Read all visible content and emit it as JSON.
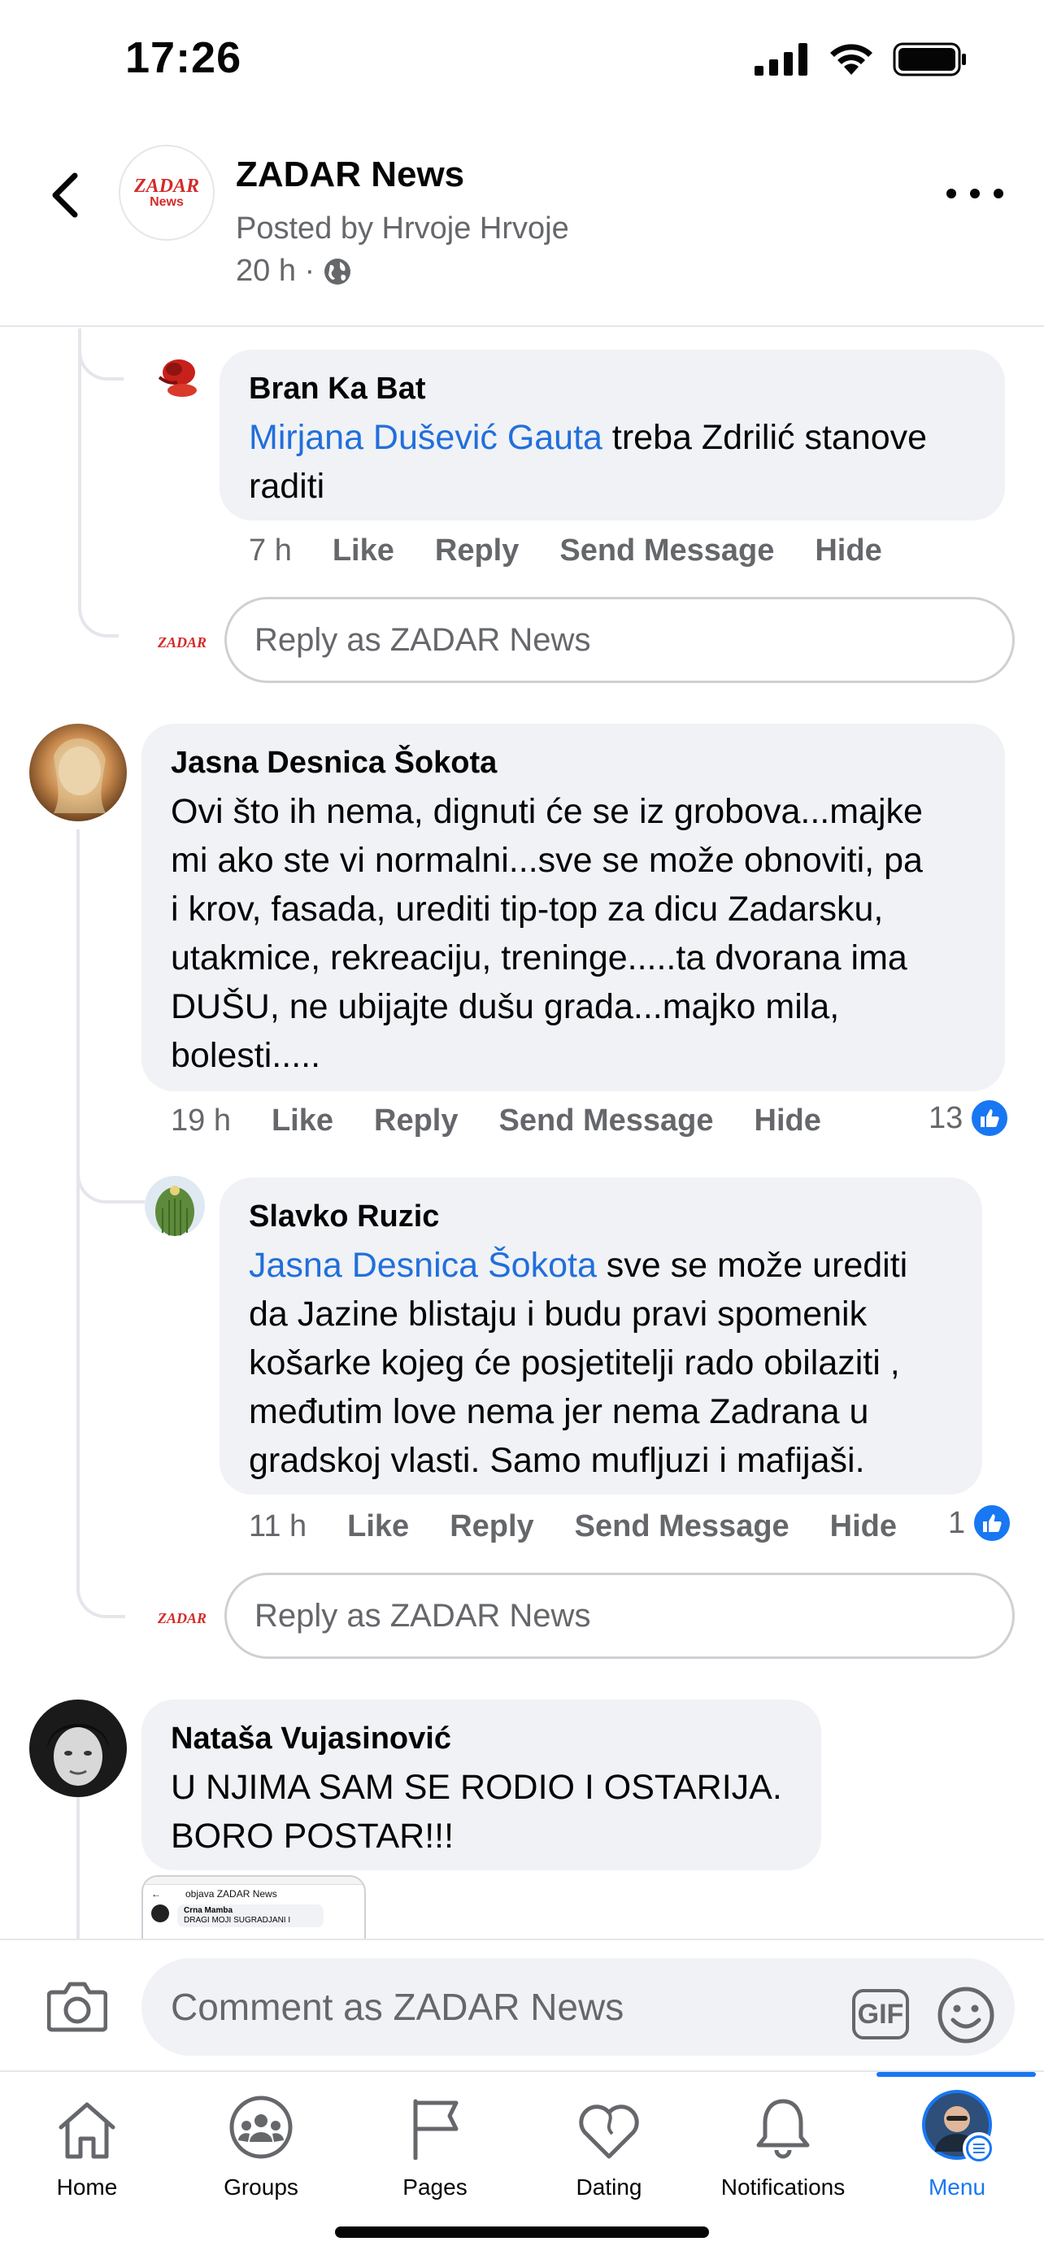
{
  "status": {
    "time": "17:26"
  },
  "header": {
    "page_name": "ZADAR News",
    "posted_by": "Posted by Hrvoje Hrvoje",
    "time": "20 h ·",
    "logo_text": "ZADAR",
    "logo_sub": "News"
  },
  "comments": [
    {
      "author": "Bran Ka Bat",
      "mention": "Mirjana Dušević Gauta",
      "text_line1_rest": " treba Zdrilić stanove",
      "text_line2": "raditi",
      "time": "7 h",
      "actions": [
        "Like",
        "Reply",
        "Send Message",
        "Hide"
      ]
    },
    {
      "author": "Jasna Desnica Šokota",
      "lines": [
        "Ovi što ih nema, dignuti će se iz grobova...majke",
        "mi ako ste vi normalni...sve se može obnoviti, pa",
        "i krov, fasada, urediti tip-top za dicu Zadarsku,",
        "utakmice, rekreaciju, treninge.....ta dvorana ima",
        "DUŠU, ne ubijajte dušu grada...majko mila,",
        "bolesti....."
      ],
      "time": "19 h",
      "actions": [
        "Like",
        "Reply",
        "Send Message",
        "Hide"
      ],
      "reactions": "13"
    },
    {
      "author": "Slavko Ruzic",
      "mention": "Jasna Desnica Šokota",
      "line1_rest": " sve se može urediti",
      "lines": [
        "da Jazine blistaju i budu pravi spomenik",
        "košarke kojeg će posjetitelji rado obilaziti ,",
        "međutim love nema jer nema Zadrana u",
        "gradskoj vlasti. Samo mufljuzi i mafijaši."
      ],
      "time": "11 h",
      "actions": [
        "Like",
        "Reply",
        "Send Message",
        "Hide"
      ],
      "reactions": "1"
    },
    {
      "author": "Nataša Vujasinović",
      "lines": [
        "U NJIMA SAM SE RODIO I OSTARIJA.",
        "BORO POSTAR!!!"
      ]
    }
  ],
  "reply_placeholder": "Reply as ZADAR News",
  "attachment": {
    "title": "objava ZADAR News",
    "author": "Crna Mamba",
    "text": "DRAGI MOJI SUGRADJANI I"
  },
  "composer": {
    "placeholder": "Comment as ZADAR News",
    "gif_label": "GIF"
  },
  "tabs": [
    {
      "label": "Home",
      "icon": "home-icon"
    },
    {
      "label": "Groups",
      "icon": "groups-icon"
    },
    {
      "label": "Pages",
      "icon": "flag-icon"
    },
    {
      "label": "Dating",
      "icon": "heart-icon"
    },
    {
      "label": "Notifications",
      "icon": "bell-icon"
    },
    {
      "label": "Menu",
      "icon": "profile-avatar",
      "active": true
    }
  ],
  "colors": {
    "accent": "#1877f2",
    "mention": "#216fdb",
    "bubble": "#f0f2f5",
    "secondary_text": "#65676b"
  }
}
